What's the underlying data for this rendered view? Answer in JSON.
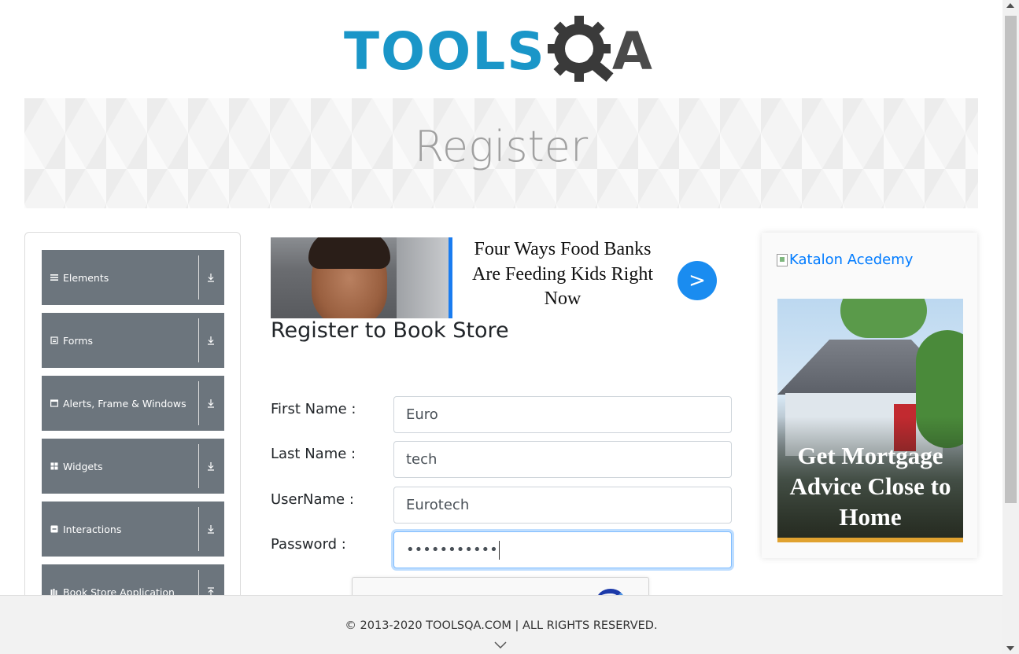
{
  "header": {
    "logo_main": "TOOLS",
    "logo_suffix": "A",
    "logo_alt": "TOOLSQA"
  },
  "banner": {
    "title": "Register"
  },
  "sidebar": {
    "items": [
      {
        "label": "Elements",
        "icon": "hamburger-icon"
      },
      {
        "label": "Forms",
        "icon": "form-icon"
      },
      {
        "label": "Alerts, Frame & Windows",
        "icon": "window-icon"
      },
      {
        "label": "Widgets",
        "icon": "grid-icon"
      },
      {
        "label": "Interactions",
        "icon": "interaction-icon"
      },
      {
        "label": "Book Store Application",
        "icon": "book-icon"
      }
    ]
  },
  "ad_top": {
    "headline": "Four Ways Food Banks Are Feeding Kids Right Now",
    "cta": ">"
  },
  "form": {
    "title": "Register to Book Store",
    "first_name_label": "First Name :",
    "first_name_value": "Euro",
    "last_name_label": "Last Name :",
    "last_name_value": "tech",
    "username_label": "UserName :",
    "username_value": "Eurotech",
    "password_label": "Password :",
    "password_value": "•••••••••••"
  },
  "ad_right": {
    "link_text": "Katalon Acedemy",
    "headline": "Get Mortgage Advice Close to Home",
    "accent_color": "#e0a230"
  },
  "footer": {
    "copyright": "© 2013-2020 TOOLSQA.COM | ALL RIGHTS RESERVED."
  },
  "colors": {
    "brand_blue": "#1a96c8",
    "sidebar_bg": "#6c757d",
    "link_blue": "#007bff"
  }
}
